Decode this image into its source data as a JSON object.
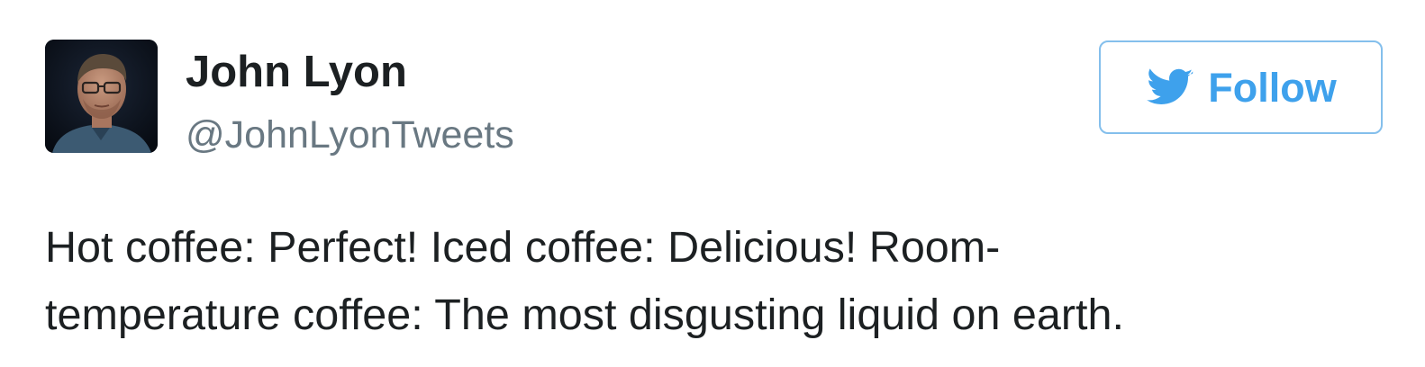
{
  "tweet": {
    "author": {
      "display_name": "John Lyon",
      "handle": "@JohnLyonTweets",
      "avatar_icon": "profile-photo"
    },
    "follow_button": {
      "label": "Follow",
      "icon": "twitter-bird-icon",
      "color": "#3ea1ec",
      "border_color": "#84bfec"
    },
    "text_lines": [
      "Hot coffee: Perfect! Iced coffee: Delicious! Room-",
      "temperature coffee: The most disgusting liquid on earth."
    ]
  },
  "colors": {
    "name": "#1c2022",
    "handle": "#697882",
    "accent": "#1da1f2"
  }
}
